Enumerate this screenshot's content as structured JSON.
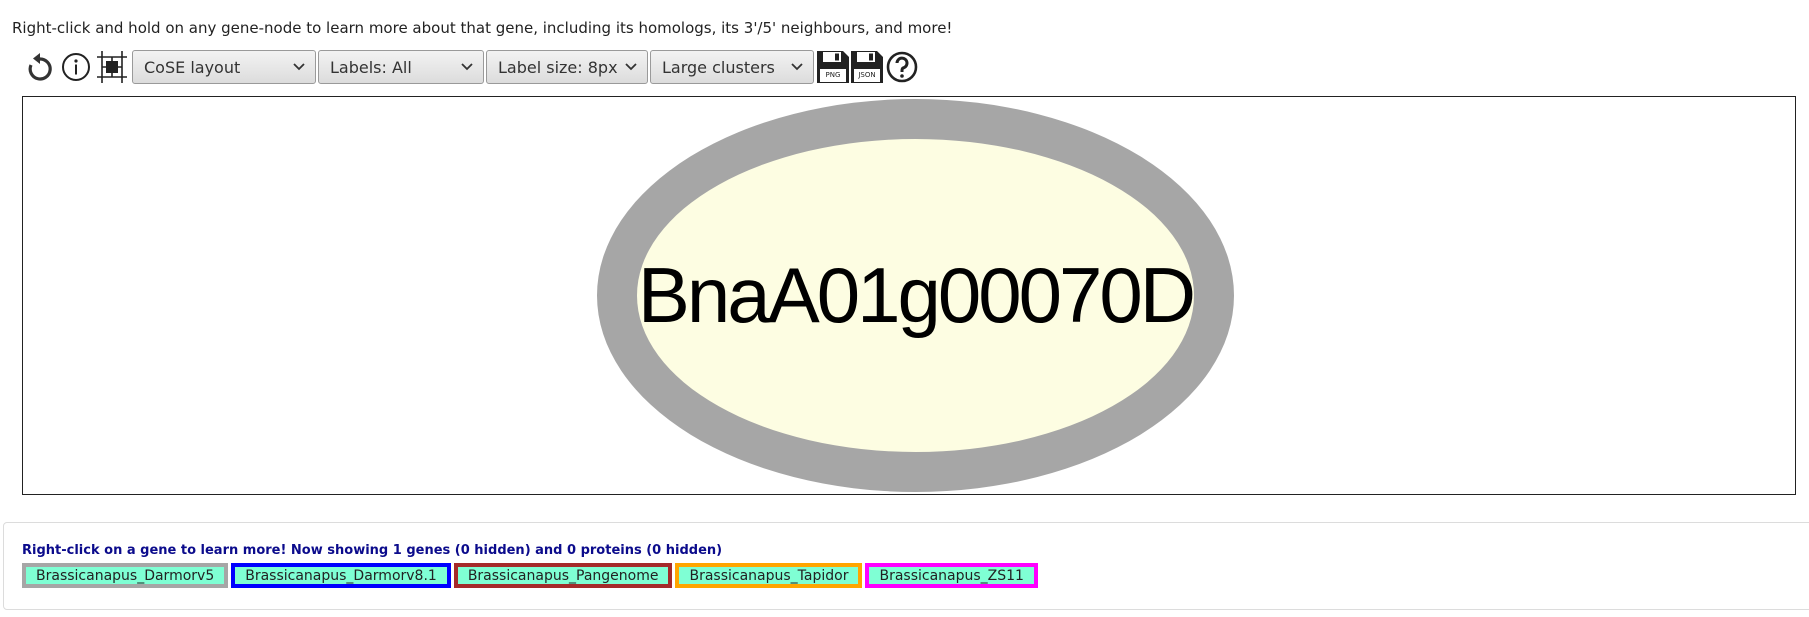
{
  "hint_text": "Right-click and hold on any gene-node to learn more about that gene, including its homologs, its 3'/5' neighbours, and more!",
  "toolbar": {
    "reset_icon": "reset-icon",
    "info_icon": "info-icon",
    "grid_icon": "grid-icon",
    "layout_select": "CoSE layout",
    "labels_select": "Labels: All",
    "label_size_select": "Label size: 8px",
    "clusters_select": "Large clusters",
    "save_png_label": "PNG",
    "save_json_label": "JSON",
    "help_icon": "help-icon"
  },
  "graph": {
    "node_label": "BnaA01g00070D",
    "node_fill": "#fdfde2",
    "node_border": "#a6a6a6"
  },
  "status_text": "Right-click on a gene to learn more! Now showing 1 genes (0 hidden) and 0 proteins (0 hidden)",
  "legend": [
    {
      "label": "Brassicanapus_Darmorv5",
      "color": "#a6a6a6"
    },
    {
      "label": "Brassicanapus_Darmorv8.1",
      "color": "#0000ff"
    },
    {
      "label": "Brassicanapus_Pangenome",
      "color": "#a52a2a"
    },
    {
      "label": "Brassicanapus_Tapidor",
      "color": "#ffa500"
    },
    {
      "label": "Brassicanapus_ZS11",
      "color": "#ff00ff"
    }
  ]
}
